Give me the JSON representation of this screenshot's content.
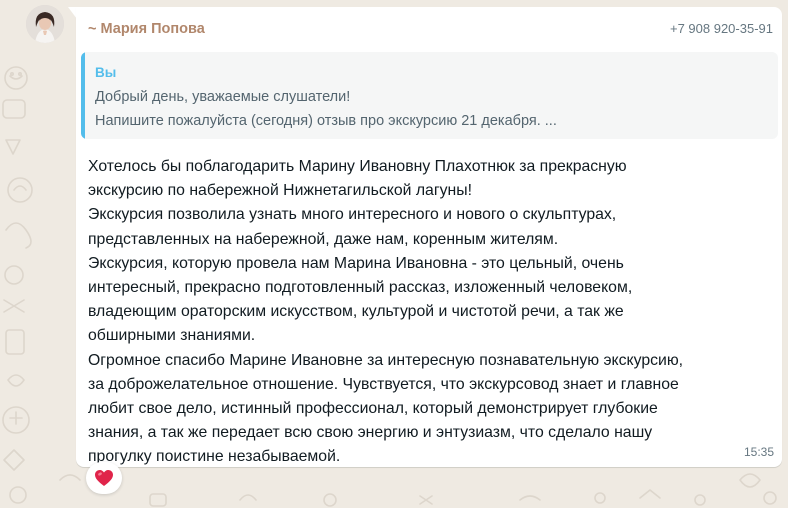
{
  "message": {
    "sender_name": "~ Мария Попова",
    "sender_phone": "+7 908 920-35-91",
    "quoted": {
      "author": "Вы",
      "lines": [
        "Добрый день, уважаемые слушатели!",
        "Напишите пожалуйста (сегодня) отзыв про экскурсию 21 декабря. ..."
      ]
    },
    "body_lines": [
      "Хотелось бы поблагодарить Марину Ивановну Плахотнюк за прекрасную",
      "экскурсию по набережной Нижнетагильской лагуны!",
      "Экскурсия позволила узнать много интересного и нового о скульптурах,",
      "представленных на набережной, даже нам, коренным жителям.",
      "Экскурсия, которую провела нам Марина Ивановна - это цельный, очень",
      "интересный, прекрасно подготовленный рассказ, изложенный человеком,",
      "владеющим ораторским искусством, культурой и чистотой речи, а так же",
      "обширными знаниями.",
      "Огромное спасибо Марине Ивановне за интересную познавательную экскурсию,",
      "за доброжелательное отношение. Чувствуется, что экскурсовод знает и главное",
      "любит свое дело, истинный профессионал, который демонстрирует глубокие",
      "знания, а так же передает всю свою энергию и энтузиазм, что сделало нашу",
      "прогулку поистине незабываемой."
    ],
    "time": "15:35",
    "reaction_icon": "red-heart-icon"
  },
  "colors": {
    "chat_background": "#efeae2",
    "bubble": "#ffffff",
    "sender_name": "#b1876c",
    "quote_accent": "#53bdeb",
    "text": "#111b21",
    "meta": "#667781"
  }
}
